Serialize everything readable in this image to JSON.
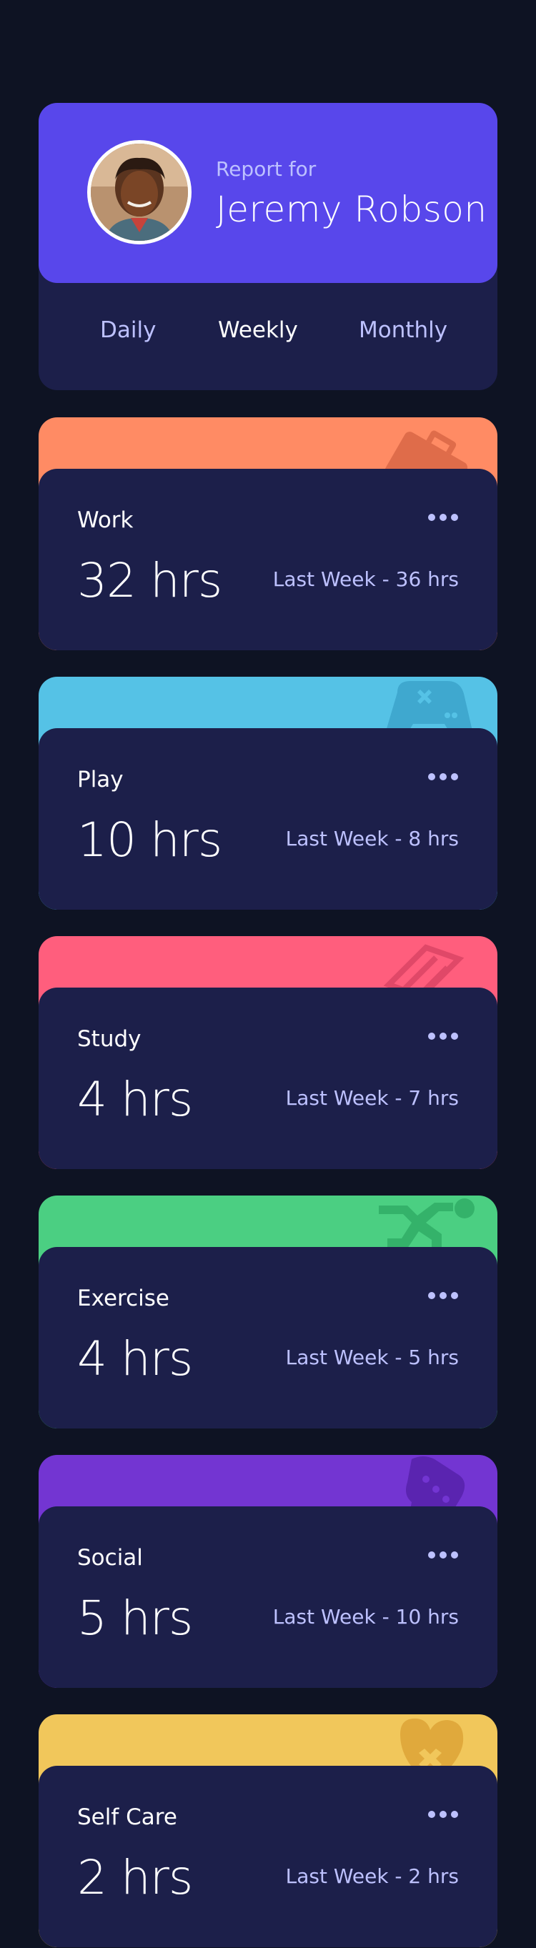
{
  "profile": {
    "report_label": "Report for",
    "name": "Jeremy Robson",
    "tabs": [
      {
        "label": "Daily",
        "active": false
      },
      {
        "label": "Weekly",
        "active": true
      },
      {
        "label": "Monthly",
        "active": false
      }
    ]
  },
  "colors": {
    "background": "#0e1323",
    "card": "#1c1f4a",
    "profile_header": "#5847eb",
    "muted_text": "#bdc1ff",
    "work": "#ff8b64",
    "play": "#55c2e6",
    "study": "#ff5e7d",
    "exercise": "#4bcf82",
    "social": "#7335d2",
    "self_care": "#f1c75b"
  },
  "cards": [
    {
      "title": "Work",
      "hours": "32 hrs",
      "previous": "Last Week - 36 hrs",
      "icon": "briefcase-icon"
    },
    {
      "title": "Play",
      "hours": "10 hrs",
      "previous": "Last Week - 8 hrs",
      "icon": "gamepad-icon"
    },
    {
      "title": "Study",
      "hours": "4 hrs",
      "previous": "Last Week - 7 hrs",
      "icon": "book-icon"
    },
    {
      "title": "Exercise",
      "hours": "4 hrs",
      "previous": "Last Week - 5 hrs",
      "icon": "running-icon"
    },
    {
      "title": "Social",
      "hours": "5 hrs",
      "previous": "Last Week - 10 hrs",
      "icon": "chat-bubble-icon"
    },
    {
      "title": "Self Care",
      "hours": "2 hrs",
      "previous": "Last Week - 2 hrs",
      "icon": "heart-bandage-icon"
    }
  ]
}
